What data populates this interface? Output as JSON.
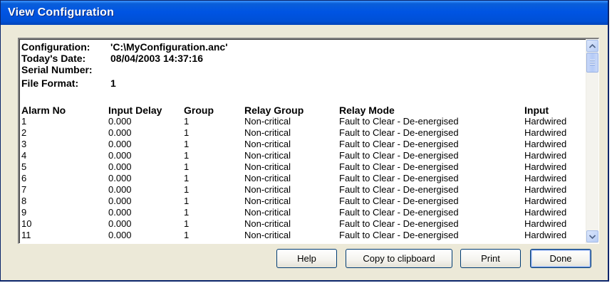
{
  "window": {
    "title": "View Configuration"
  },
  "report": {
    "header": [
      {
        "label": "Configuration:",
        "value": "'C:\\MyConfiguration.anc'"
      },
      {
        "label": "Today's Date:",
        "value": "08/04/2003 14:37:16"
      },
      {
        "label": "Serial Number:",
        "value": ""
      },
      {
        "label": "File Format:",
        "value": "1"
      }
    ],
    "columns": [
      "Alarm No",
      "Input Delay",
      "Group",
      "Relay Group",
      "Relay Mode",
      "Input"
    ],
    "rows": [
      [
        "1",
        "0.000",
        "1",
        "Non-critical",
        "Fault to Clear - De-energised",
        "Hardwired"
      ],
      [
        "2",
        "0.000",
        "1",
        "Non-critical",
        "Fault to Clear - De-energised",
        "Hardwired"
      ],
      [
        "3",
        "0.000",
        "1",
        "Non-critical",
        "Fault to Clear - De-energised",
        "Hardwired"
      ],
      [
        "4",
        "0.000",
        "1",
        "Non-critical",
        "Fault to Clear - De-energised",
        "Hardwired"
      ],
      [
        "5",
        "0.000",
        "1",
        "Non-critical",
        "Fault to Clear - De-energised",
        "Hardwired"
      ],
      [
        "6",
        "0.000",
        "1",
        "Non-critical",
        "Fault to Clear - De-energised",
        "Hardwired"
      ],
      [
        "7",
        "0.000",
        "1",
        "Non-critical",
        "Fault to Clear - De-energised",
        "Hardwired"
      ],
      [
        "8",
        "0.000",
        "1",
        "Non-critical",
        "Fault to Clear - De-energised",
        "Hardwired"
      ],
      [
        "9",
        "0.000",
        "1",
        "Non-critical",
        "Fault to Clear - De-energised",
        "Hardwired"
      ],
      [
        "10",
        "0.000",
        "1",
        "Non-critical",
        "Fault to Clear - De-energised",
        "Hardwired"
      ],
      [
        "11",
        "0.000",
        "1",
        "Non-critical",
        "Fault to Clear - De-energised",
        "Hardwired"
      ]
    ]
  },
  "buttons": {
    "help": "Help",
    "copy": "Copy to clipboard",
    "print": "Print",
    "done": "Done"
  },
  "icons": {
    "scroll_up": "scroll-up-arrow-icon",
    "scroll_down": "scroll-down-arrow-icon"
  },
  "colors": {
    "titlebar": "#0054e3",
    "dialog_face": "#ece9d8",
    "button_border": "#003c74"
  }
}
